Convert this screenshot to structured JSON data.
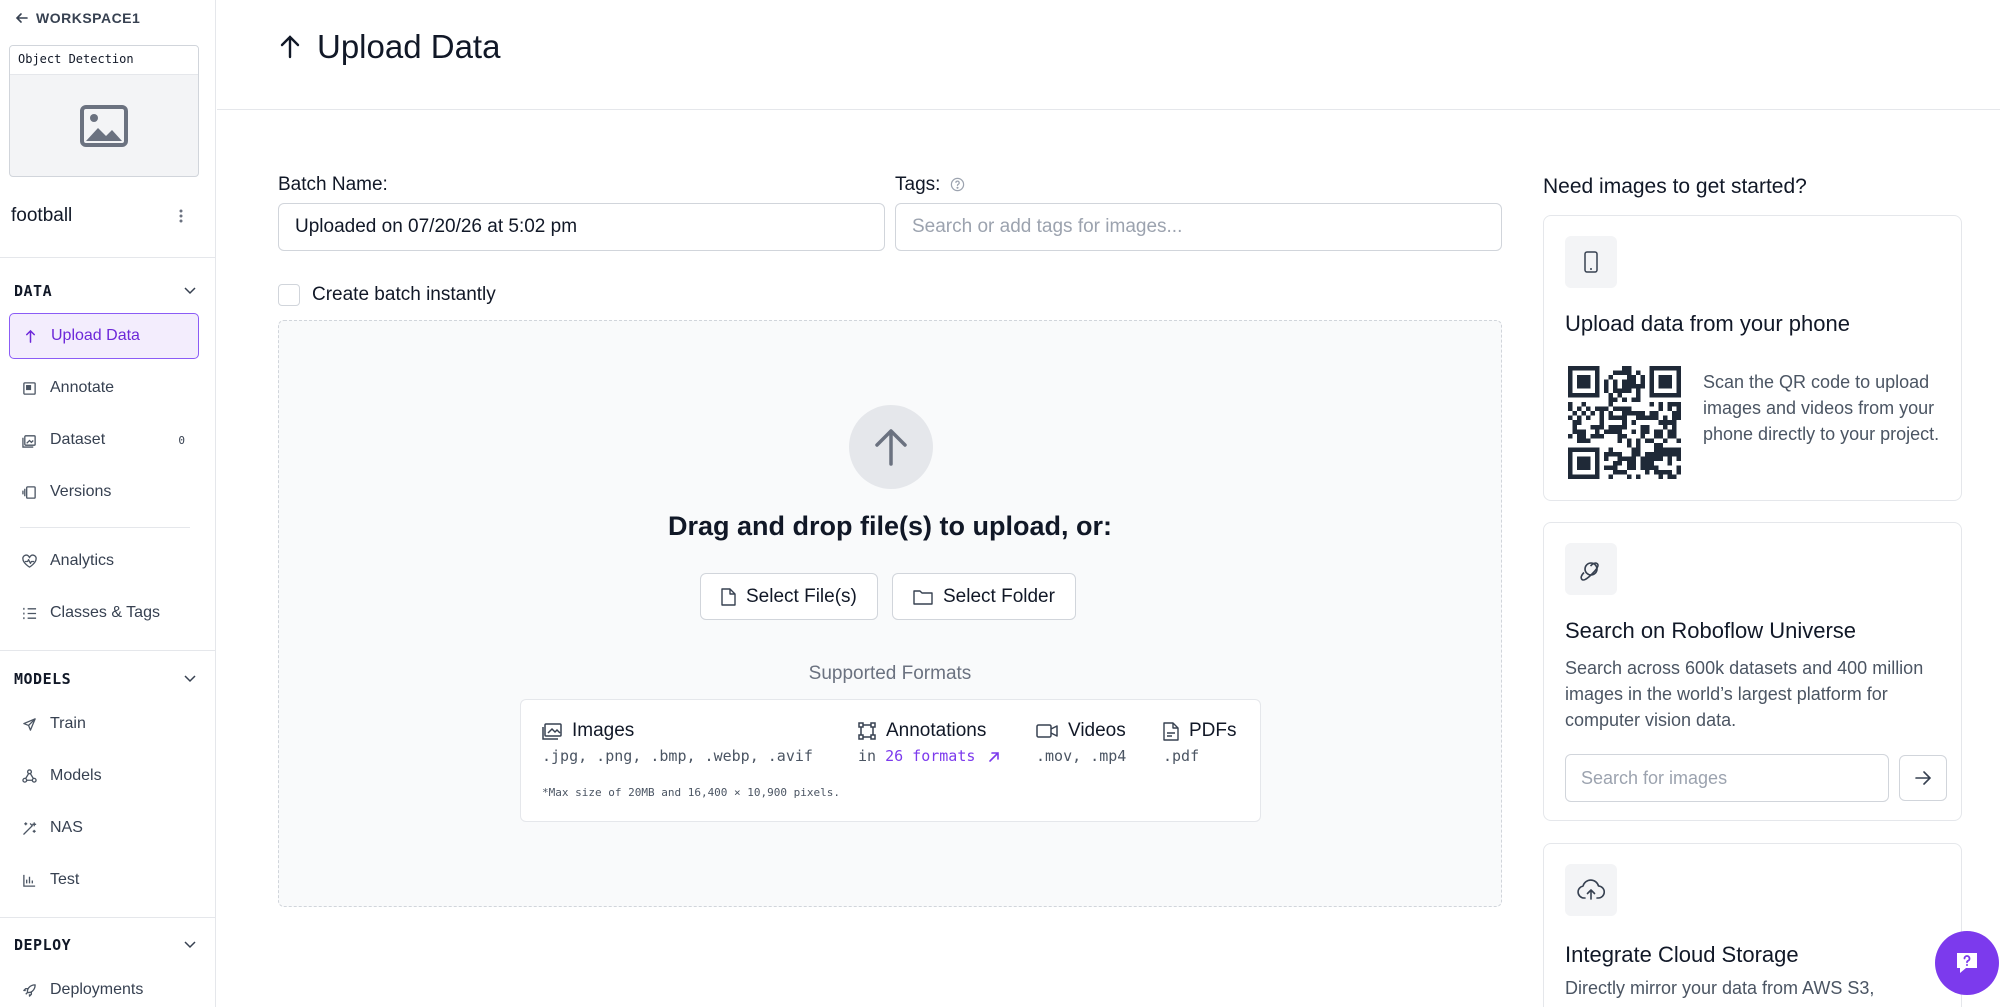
{
  "sidebar": {
    "workspace": "WORKSPACE1",
    "project_type": "Object Detection",
    "project_name": "football",
    "sections": {
      "data": "DATA",
      "models": "MODELS",
      "deploy": "DEPLOY"
    },
    "items": {
      "upload": "Upload Data",
      "annotate": "Annotate",
      "dataset": "Dataset",
      "dataset_count": "0",
      "versions": "Versions",
      "analytics": "Analytics",
      "classes": "Classes & Tags",
      "train": "Train",
      "models": "Models",
      "nas": "NAS",
      "test": "Test",
      "deployments": "Deployments"
    }
  },
  "header": {
    "title": "Upload Data"
  },
  "form": {
    "batch_label": "Batch Name:",
    "batch_value": "Uploaded on 07/20/26 at 5:02 pm",
    "tags_label": "Tags:",
    "tags_placeholder": "Search or add tags for images...",
    "create_batch_label": "Create batch instantly"
  },
  "dropzone": {
    "title": "Drag and drop file(s) to upload, or:",
    "select_files": "Select File(s)",
    "select_folder": "Select Folder",
    "supported_title": "Supported Formats",
    "formats": {
      "images": {
        "label": "Images",
        "exts": ".jpg, .png, .bmp, .webp, .avif"
      },
      "annotations": {
        "label": "Annotations",
        "prefix": "in",
        "link": "26 formats"
      },
      "videos": {
        "label": "Videos",
        "exts": ".mov, .mp4"
      },
      "pdfs": {
        "label": "PDFs",
        "exts": ".pdf"
      }
    },
    "note": "*Max size of 20MB and 16,400 × 10,900 pixels."
  },
  "right_panel": {
    "title": "Need images to get started?",
    "phone": {
      "title": "Upload data from your phone",
      "text": "Scan the QR code to upload images and videos from your phone directly to your project."
    },
    "universe": {
      "title": "Search on Roboflow Universe",
      "text": "Search across 600k datasets and 400 million images in the world’s largest platform for computer vision data.",
      "search_placeholder": "Search for images"
    },
    "cloud": {
      "title": "Integrate Cloud Storage",
      "text": "Directly mirror your data from AWS S3,"
    }
  },
  "colors": {
    "accent": "#7c3aed",
    "active_bg": "#f3edfd",
    "border": "#e5e7eb"
  }
}
